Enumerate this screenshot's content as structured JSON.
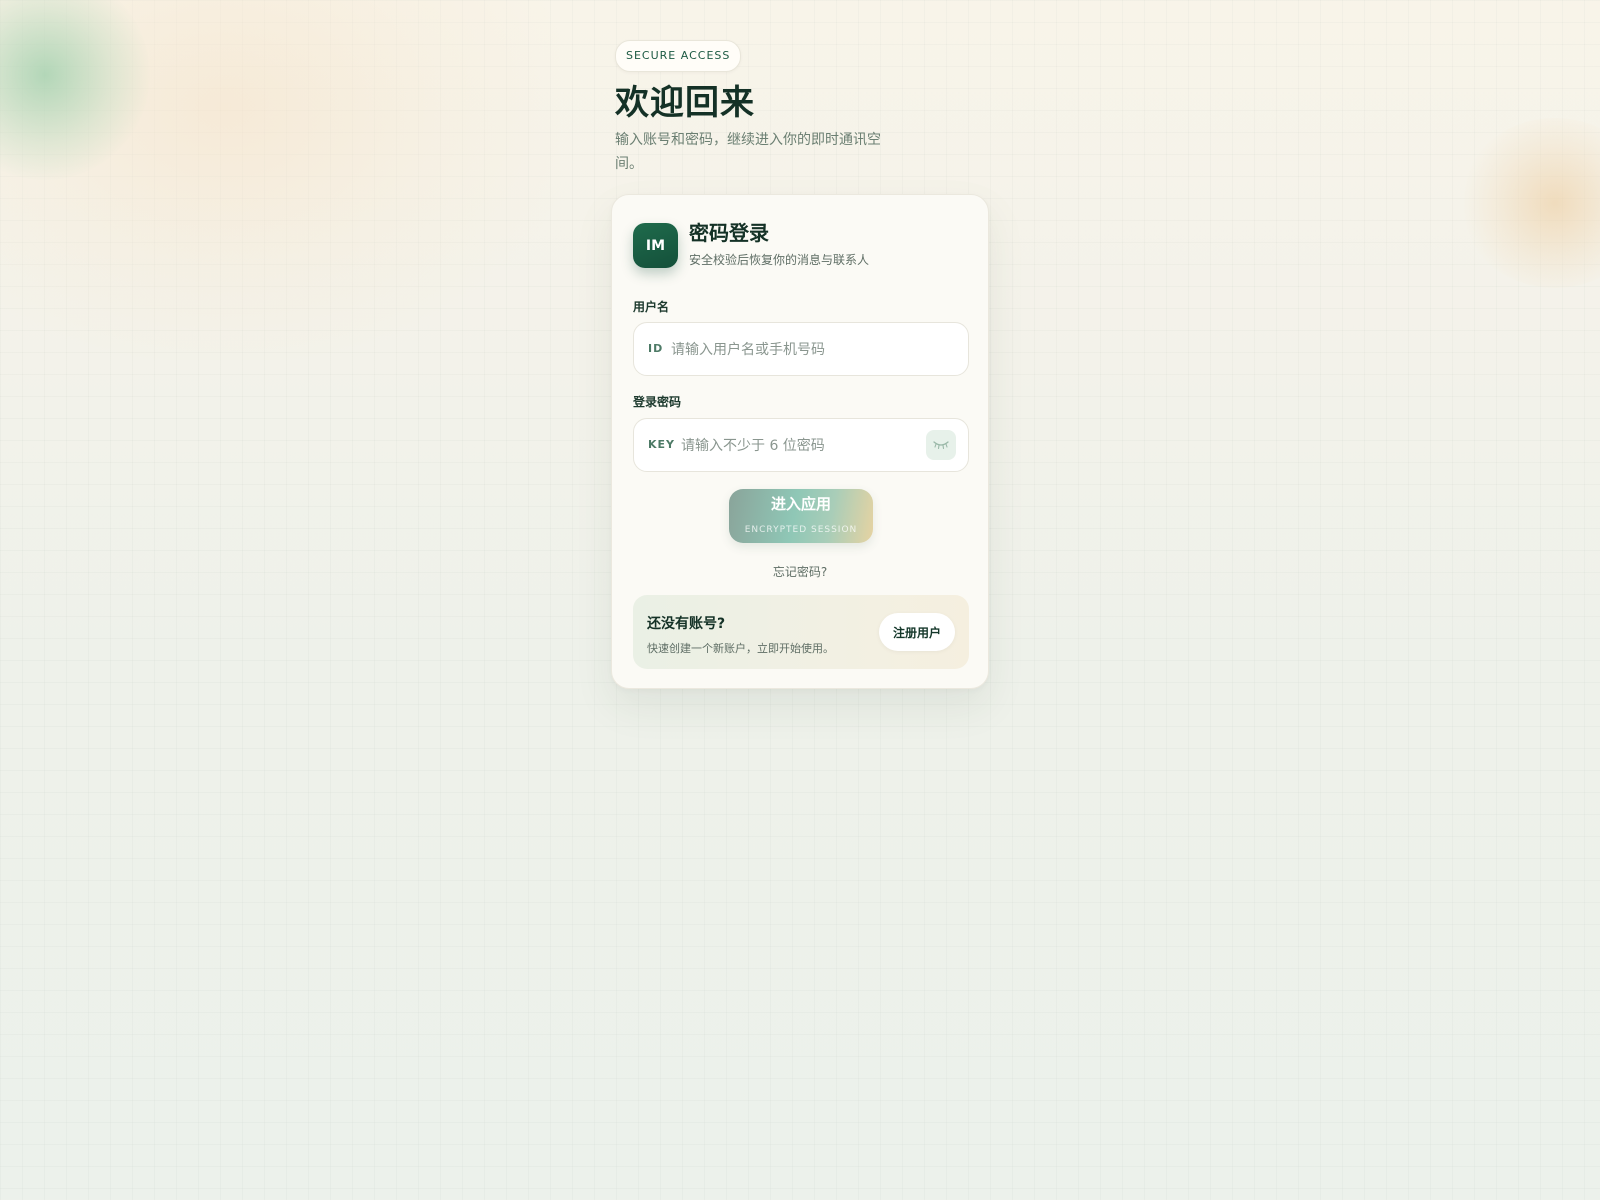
{
  "hero": {
    "badge": "SECURE ACCESS",
    "title": "欢迎回来",
    "subtitle": "输入账号和密码，继续进入你的即时通讯空间。"
  },
  "card": {
    "logo": "IM",
    "title": "密码登录",
    "subtitle": "安全校验后恢复你的消息与联系人"
  },
  "username": {
    "label": "用户名",
    "tag": "ID",
    "placeholder": "请输入用户名或手机号码",
    "value": ""
  },
  "password": {
    "label": "登录密码",
    "tag": "KEY",
    "placeholder": "请输入不少于 6 位密码",
    "value": "",
    "toggle_icon": "eye-closed-icon"
  },
  "submit": {
    "label": "进入应用",
    "sublabel": "ENCRYPTED SESSION"
  },
  "forgot": "忘记密码?",
  "register": {
    "title": "还没有账号?",
    "subtitle": "快速创建一个新账户，立即开始使用。",
    "button": "注册用户"
  },
  "colors": {
    "primary": "#1a5c43",
    "text": "#143126",
    "muted": "#5f6e65"
  }
}
